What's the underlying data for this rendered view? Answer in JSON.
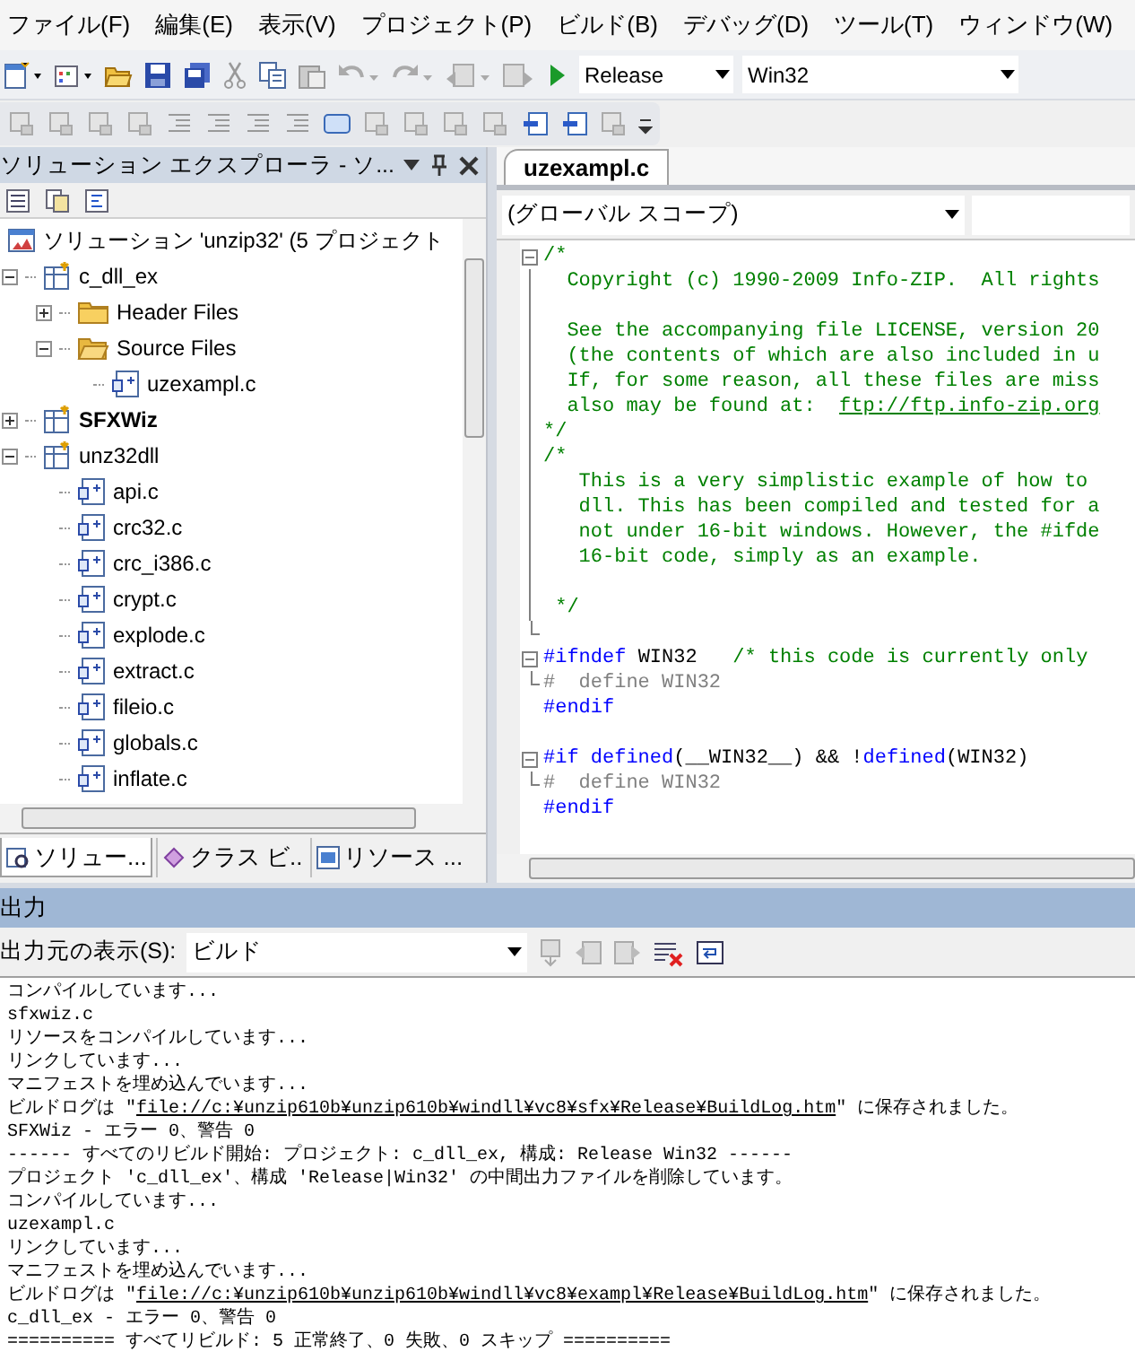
{
  "menu": [
    "ファイル(F)",
    "編集(E)",
    "表示(V)",
    "プロジェクト(P)",
    "ビルド(B)",
    "デバッグ(D)",
    "ツール(T)",
    "ウィンドウ(W)"
  ],
  "toolbar": {
    "configuration": "Release",
    "platform": "Win32"
  },
  "solution_explorer": {
    "title": "ソリューション エクスプローラ - ソ...",
    "tree": [
      {
        "label": "ソリューション 'unzip32' (5 プロジェクト",
        "kind": "solution",
        "startup": false,
        "children": [
          {
            "label": "c_dll_ex",
            "kind": "project",
            "startup": false,
            "expanded": true,
            "children": [
              {
                "label": "Header Files",
                "kind": "folder",
                "startup": false,
                "expanded": false
              },
              {
                "label": "Source Files",
                "kind": "folder",
                "startup": false,
                "expanded": true,
                "children": [
                  {
                    "label": "uzexampl.c",
                    "kind": "file",
                    "startup": false
                  }
                ]
              }
            ]
          },
          {
            "label": "SFXWiz",
            "kind": "project",
            "startup": true,
            "expanded": false
          },
          {
            "label": "unz32dll",
            "kind": "project",
            "startup": false,
            "expanded": true,
            "children": [
              {
                "label": "api.c",
                "kind": "file",
                "startup": false
              },
              {
                "label": "crc32.c",
                "kind": "file",
                "startup": false
              },
              {
                "label": "crc_i386.c",
                "kind": "file",
                "startup": false
              },
              {
                "label": "crypt.c",
                "kind": "file",
                "startup": false
              },
              {
                "label": "explode.c",
                "kind": "file",
                "startup": false
              },
              {
                "label": "extract.c",
                "kind": "file",
                "startup": false
              },
              {
                "label": "fileio.c",
                "kind": "file",
                "startup": false
              },
              {
                "label": "globals.c",
                "kind": "file",
                "startup": false
              },
              {
                "label": "inflate.c",
                "kind": "file",
                "startup": false
              }
            ]
          }
        ]
      }
    ],
    "tabs": [
      {
        "label": "ソリュー...",
        "kind": "solution",
        "selected": true
      },
      {
        "label": "クラス ビ..",
        "kind": "class",
        "selected": false
      },
      {
        "label": "リソース ...",
        "kind": "resource",
        "selected": false
      }
    ]
  },
  "editor": {
    "tabs": [
      {
        "label": "uzexampl.c",
        "selected": true
      }
    ],
    "scope": "(グローバル スコープ)",
    "lines": [
      {
        "kind": "open",
        "segments": [
          {
            "kind": "comment",
            "text": "/*"
          }
        ]
      },
      {
        "kind": "line",
        "segments": [
          {
            "kind": "comment",
            "text": "  Copyright (c) 1990-2009 Info-ZIP.  All rights"
          }
        ]
      },
      {
        "kind": "line"
      },
      {
        "kind": "line",
        "segments": [
          {
            "kind": "comment",
            "text": "  See the accompanying file LICENSE, version 20"
          }
        ]
      },
      {
        "kind": "line",
        "segments": [
          {
            "kind": "comment",
            "text": "  (the contents of which are also included in u"
          }
        ]
      },
      {
        "kind": "line",
        "segments": [
          {
            "kind": "comment",
            "text": "  If, for some reason, all these files are miss"
          }
        ]
      },
      {
        "kind": "line",
        "segments": [
          {
            "kind": "comment",
            "text": "  also may be found at:  "
          },
          {
            "kind": "link",
            "text": "ftp://ftp.info-zip.org"
          }
        ]
      },
      {
        "kind": "line",
        "segments": [
          {
            "kind": "comment",
            "text": "*/"
          }
        ]
      },
      {
        "kind": "line",
        "segments": [
          {
            "kind": "comment",
            "text": "/*"
          }
        ]
      },
      {
        "kind": "line",
        "segments": [
          {
            "kind": "comment",
            "text": "   This is a very simplistic example of how to"
          }
        ]
      },
      {
        "kind": "line",
        "segments": [
          {
            "kind": "comment",
            "text": "   dll. This has been compiled and tested for a"
          }
        ]
      },
      {
        "kind": "line",
        "segments": [
          {
            "kind": "comment",
            "text": "   not under 16-bit windows. However, the #ifde"
          }
        ]
      },
      {
        "kind": "line",
        "segments": [
          {
            "kind": "comment",
            "text": "   16-bit code, simply as an example."
          }
        ]
      },
      {
        "kind": "line"
      },
      {
        "kind": "line",
        "segments": [
          {
            "kind": "comment",
            "text": " */"
          }
        ]
      },
      {
        "kind": "end"
      },
      {
        "kind": "open",
        "segments": [
          {
            "kind": "keyword",
            "text": "#ifndef"
          },
          {
            "kind": "text",
            "text": " WIN32   "
          },
          {
            "kind": "comment",
            "text": "/* this code is currently only"
          }
        ]
      },
      {
        "kind": "end",
        "segments": [
          {
            "kind": "inactive",
            "text": "#  define WIN32"
          }
        ]
      },
      {
        "kind": "none",
        "segments": [
          {
            "kind": "keyword",
            "text": "#endif"
          }
        ]
      },
      {
        "kind": "none"
      },
      {
        "kind": "open",
        "segments": [
          {
            "kind": "keyword",
            "text": "#if defined"
          },
          {
            "kind": "text",
            "text": "(__WIN32__) && !"
          },
          {
            "kind": "keyword",
            "text": "defined"
          },
          {
            "kind": "text",
            "text": "(WIN32)"
          }
        ]
      },
      {
        "kind": "end",
        "segments": [
          {
            "kind": "inactive",
            "text": "#  define WIN32"
          }
        ]
      },
      {
        "kind": "none",
        "segments": [
          {
            "kind": "keyword",
            "text": "#endif"
          }
        ]
      }
    ]
  },
  "output": {
    "title": "出力",
    "source_label": "出力元の表示(S):",
    "source": "ビルド",
    "lines": [
      [
        {
          "kind": "text",
          "text": "コンパイルしています..."
        }
      ],
      [
        {
          "kind": "text",
          "text": "sfxwiz.c"
        }
      ],
      [
        {
          "kind": "text",
          "text": "リソースをコンパイルしています..."
        }
      ],
      [
        {
          "kind": "text",
          "text": "リンクしています..."
        }
      ],
      [
        {
          "kind": "text",
          "text": "マニフェストを埋め込んでいます..."
        }
      ],
      [
        {
          "kind": "text",
          "text": "ビルドログは \""
        },
        {
          "kind": "link",
          "text": "file://c:¥unzip610b¥unzip610b¥windll¥vc8¥sfx¥Release¥BuildLog.htm"
        },
        {
          "kind": "text",
          "text": "\" に保存されました。"
        }
      ],
      [
        {
          "kind": "text",
          "text": "SFXWiz - エラー 0、警告 0"
        }
      ],
      [
        {
          "kind": "text",
          "text": "------ すべてのリビルド開始: プロジェクト: c_dll_ex, 構成: Release Win32 ------"
        }
      ],
      [
        {
          "kind": "text",
          "text": "プロジェクト 'c_dll_ex'、構成 'Release|Win32' の中間出力ファイルを削除しています。"
        }
      ],
      [
        {
          "kind": "text",
          "text": "コンパイルしています..."
        }
      ],
      [
        {
          "kind": "text",
          "text": "uzexampl.c"
        }
      ],
      [
        {
          "kind": "text",
          "text": "リンクしています..."
        }
      ],
      [
        {
          "kind": "text",
          "text": "マニフェストを埋め込んでいます..."
        }
      ],
      [
        {
          "kind": "text",
          "text": "ビルドログは \""
        },
        {
          "kind": "link",
          "text": "file://c:¥unzip610b¥unzip610b¥windll¥vc8¥exampl¥Release¥BuildLog.htm"
        },
        {
          "kind": "text",
          "text": "\" に保存されました。"
        }
      ],
      [
        {
          "kind": "text",
          "text": "c_dll_ex - エラー 0、警告 0"
        }
      ],
      [
        {
          "kind": "text",
          "text": "========== すべてリビルド: 5 正常終了、0 失敗、0 スキップ =========="
        }
      ]
    ]
  }
}
